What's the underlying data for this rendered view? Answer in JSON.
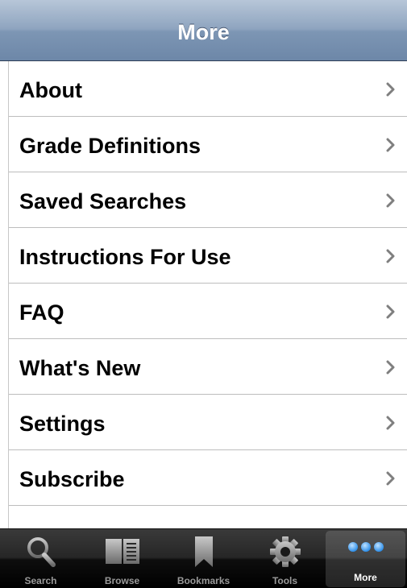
{
  "navbar": {
    "title": "More"
  },
  "list": {
    "items": [
      {
        "label": "About"
      },
      {
        "label": "Grade Definitions"
      },
      {
        "label": "Saved Searches"
      },
      {
        "label": "Instructions For Use"
      },
      {
        "label": "FAQ"
      },
      {
        "label": "What's New"
      },
      {
        "label": "Settings"
      },
      {
        "label": "Subscribe"
      }
    ]
  },
  "tabbar": {
    "selected": "More",
    "tabs": [
      {
        "label": "Search",
        "icon": "search-icon"
      },
      {
        "label": "Browse",
        "icon": "book-icon"
      },
      {
        "label": "Bookmarks",
        "icon": "bookmark-icon"
      },
      {
        "label": "Tools",
        "icon": "gear-icon"
      },
      {
        "label": "More",
        "icon": "more-dots-icon"
      }
    ]
  },
  "colors": {
    "navbar": "#7d96b4",
    "tabbar": "#1a1a1a",
    "selected_tab_accent": "#2a8fe8"
  }
}
